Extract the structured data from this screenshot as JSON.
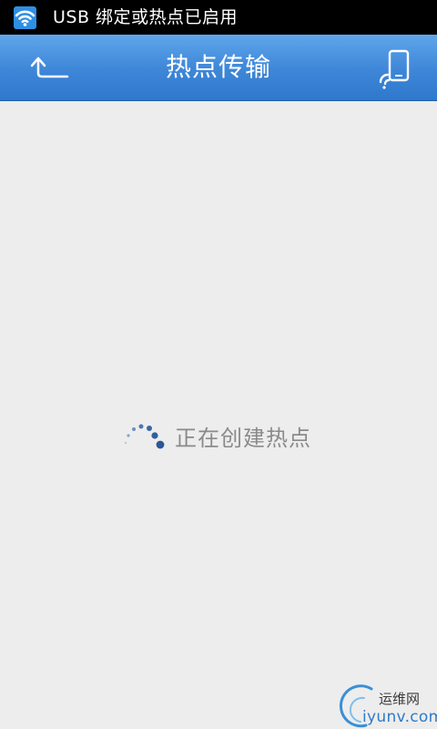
{
  "status_bar": {
    "notification_text": "USB 绑定或热点已启用",
    "icon": "wifi-hotspot-icon"
  },
  "title_bar": {
    "title": "热点传输",
    "back_icon": "back-arrow-icon",
    "right_icon": "phone-connect-icon"
  },
  "main": {
    "loading_text": "正在创建热点",
    "spinner_icon": "loading-spinner-icon"
  },
  "watermark": {
    "line1": "运维网",
    "line2": "iyunv.com"
  },
  "colors": {
    "title_bar": "#3d86d8",
    "background": "#ededed",
    "spinner": "#2f5fa0"
  }
}
